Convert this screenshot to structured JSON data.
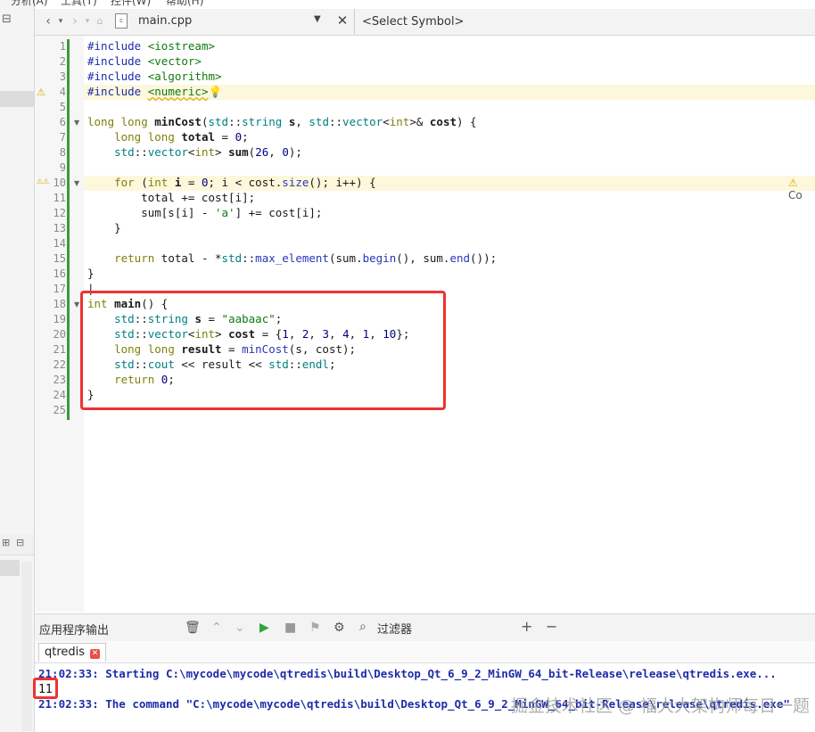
{
  "menubar": {
    "items": [
      "分析(A)",
      "工具(T)",
      "控件(W)",
      "帮助(H)"
    ]
  },
  "editor_toolbar": {
    "file_name": "main.cpp",
    "symbol_placeholder": "<Select Symbol>"
  },
  "editor": {
    "line_numbers": [
      "1",
      "2",
      "3",
      "4",
      "5",
      "6",
      "7",
      "8",
      "9",
      "10",
      "11",
      "12",
      "13",
      "14",
      "15",
      "16",
      "17",
      "18",
      "19",
      "20",
      "21",
      "22",
      "23",
      "24",
      "25"
    ],
    "inline_warning_text": "Co"
  },
  "output_pane": {
    "title": "应用程序输出",
    "filter_placeholder": "过滤器",
    "tab_label": "qtredis",
    "lines": [
      "21:02:33: Starting C:\\mycode\\mycode\\qtredis\\build\\Desktop_Qt_6_9_2_MinGW_64_bit-Release\\release\\qtredis.exe...",
      "21:02:33: The command \"C:\\mycode\\mycode\\qtredis\\build\\Desktop_Qt_6_9_2_MinGW_64_bit-Release\\release\\qtredis.exe\""
    ],
    "program_output": "11"
  },
  "watermark": "掘金技术社区 @ 福大大架构师每日一题",
  "colors": {
    "highlight_box": "#e33333",
    "change_bar": "#3a9a3a",
    "warning": "#e0a800"
  }
}
